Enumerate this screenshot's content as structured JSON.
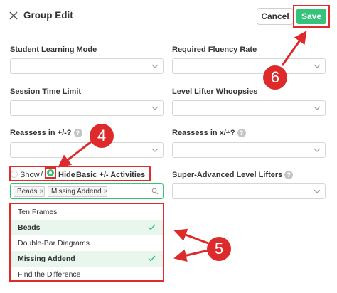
{
  "header": {
    "title": "Group Edit",
    "cancel_label": "Cancel",
    "save_label": "Save"
  },
  "fields": {
    "student_learning_mode": {
      "label": "Student Learning Mode",
      "value": ""
    },
    "required_fluency_rate": {
      "label": "Required Fluency Rate",
      "value": ""
    },
    "session_time_limit": {
      "label": "Session Time Limit",
      "value": ""
    },
    "level_lifter_whoopsies": {
      "label": "Level Lifter Whoopsies",
      "value": ""
    },
    "reassess_add_sub": {
      "label": "Reassess in +/-?",
      "value": ""
    },
    "reassess_mul_div": {
      "label": "Reassess in x/÷?",
      "value": ""
    },
    "super_advanced": {
      "label": "Super-Advanced Level Lifters",
      "value": ""
    }
  },
  "activities_toggle": {
    "show_label": "Show",
    "separator": "/",
    "hide_label": "Hide",
    "suffix": "Basic +/- Activities",
    "selected": "Hide"
  },
  "activities_select": {
    "tags": [
      "Beads",
      "Missing Addend"
    ],
    "tag_remove": "×",
    "options": [
      {
        "label": "Ten Frames",
        "selected": false
      },
      {
        "label": "Beads",
        "selected": true
      },
      {
        "label": "Double-Bar Diagrams",
        "selected": false
      },
      {
        "label": "Missing Addend",
        "selected": true
      },
      {
        "label": "Find the Difference",
        "selected": false
      }
    ]
  },
  "callouts": [
    "4",
    "5",
    "6"
  ],
  "colors": {
    "accent_green": "#35c27a",
    "annotation_red": "#dd2b2b",
    "selected_bg": "#e8f6ee"
  }
}
